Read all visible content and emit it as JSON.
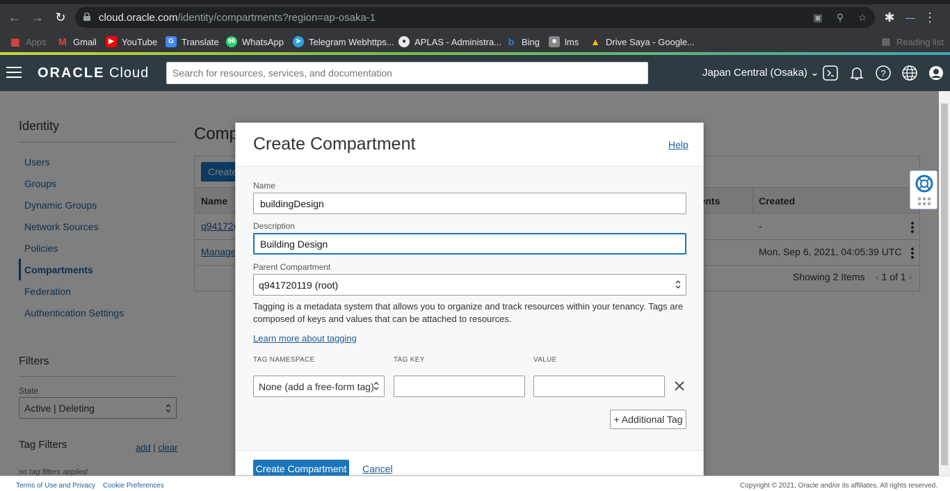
{
  "browser": {
    "url_host": "cloud.oracle.com",
    "url_path": "/identity/compartments?region=ap-osaka-1",
    "bookmarks": [
      {
        "label": "Apps",
        "color": "#e8453c"
      },
      {
        "label": "Gmail",
        "color": "#ea4335"
      },
      {
        "label": "YouTube",
        "color": "#ff0000"
      },
      {
        "label": "Translate",
        "color": "#4285f4"
      },
      {
        "label": "WhatsApp",
        "color": "#25d366"
      },
      {
        "label": "Telegram Webhttps...",
        "color": "#2aa3e0"
      },
      {
        "label": "APLAS - Administra...",
        "color": "#e8eaed"
      },
      {
        "label": "Bing",
        "color": "#2b7de9"
      },
      {
        "label": "lms",
        "color": "#888888"
      },
      {
        "label": "Drive Saya - Google...",
        "color": "#fbbc04"
      }
    ],
    "reading_list": "Reading list"
  },
  "oci_header": {
    "logo": "ORACLE",
    "logo_suffix": "Cloud",
    "search_placeholder": "Search for resources, services, and documentation",
    "region": "Japan Central (Osaka)"
  },
  "leftnav": {
    "title": "Identity",
    "items": [
      {
        "label": "Users",
        "active": false
      },
      {
        "label": "Groups",
        "active": false
      },
      {
        "label": "Dynamic Groups",
        "active": false
      },
      {
        "label": "Network Sources",
        "active": false
      },
      {
        "label": "Policies",
        "active": false
      },
      {
        "label": "Compartments",
        "active": true
      },
      {
        "label": "Federation",
        "active": false
      },
      {
        "label": "Authentication Settings",
        "active": false
      }
    ],
    "filters_title": "Filters",
    "state_label": "State",
    "state_value": "Active | Deleting",
    "tag_filters_title": "Tag Filters",
    "tag_add": "add",
    "tag_sep": " | ",
    "tag_clear": "clear",
    "no_tag_filters": "no tag filters applied"
  },
  "main": {
    "title_partial": "Comp",
    "create_button_partial": "Create",
    "columns": {
      "name": "Name",
      "children_partial": "nents",
      "created": "Created"
    },
    "rows": [
      {
        "name_partial": "q94172(",
        "created": "-"
      },
      {
        "name_partial": "Manage",
        "created": "Mon, Sep 6, 2021, 04:05:39 UTC"
      }
    ],
    "pagination": {
      "showing": "Showing 2 Items",
      "page": "1 of 1"
    }
  },
  "modal": {
    "title": "Create Compartment",
    "help": "Help",
    "name_label": "Name",
    "name_value": "buildingDesign",
    "desc_label": "Description",
    "desc_value": "Building Design",
    "parent_label": "Parent Compartment",
    "parent_value": "q941720119 (root)",
    "tagging_text": "Tagging is a metadata system that allows you to organize and track resources within your tenancy. Tags are composed of keys and values that can be attached to resources.",
    "learn_more": "Learn more about tagging",
    "tag_namespace_hdr": "TAG NAMESPACE",
    "tag_key_hdr": "TAG KEY",
    "tag_value_hdr": "VALUE",
    "tag_namespace_value": "None (add a free-form tag)",
    "tag_key_value": "",
    "tag_value_value": "",
    "add_tag": "+ Additional Tag",
    "submit": "Create Compartment",
    "cancel": "Cancel"
  },
  "footer": {
    "terms": "Terms of Use and Privacy",
    "cookies": "Cookie Preferences",
    "copyright": "Copyright © 2021, Oracle and/or its affiliates. All rights reserved."
  },
  "colors": {
    "accent": "#1b75bc",
    "header_bg": "#2e3b43",
    "link": "#1f5c9a"
  }
}
